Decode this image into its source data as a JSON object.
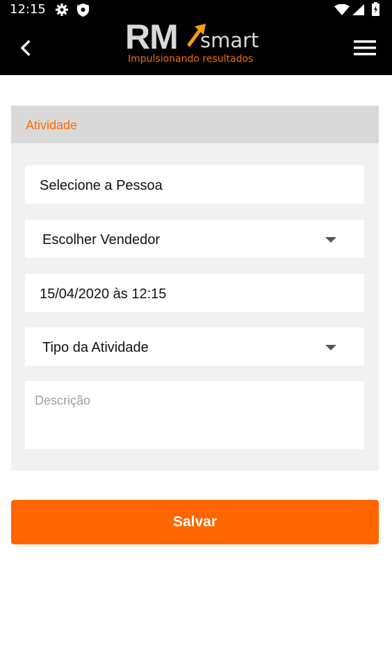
{
  "status_bar": {
    "time": "12:15",
    "icons": [
      "gear-icon",
      "shield-icon",
      "wifi-icon",
      "signal-icon",
      "battery-icon"
    ]
  },
  "app_bar": {
    "back_icon": "chevron-left-icon",
    "menu_icon": "hamburger-menu-icon",
    "logo": {
      "primary": "RM",
      "secondary": "smart",
      "tagline": "Impulsionando resultados"
    }
  },
  "form": {
    "title": "Atividade",
    "person_field": "Selecione a Pessoa",
    "seller_select": "Escolher Vendedor",
    "datetime_field": "15/04/2020 às 12:15",
    "activity_type_select": "Tipo da Atividade",
    "description_placeholder": "Descrição"
  },
  "actions": {
    "save_label": "Salvar"
  },
  "colors": {
    "accent": "#ff6600",
    "header_bg": "#000000",
    "card_bg": "#f1f1f1",
    "card_header_bg": "#d9d9d9"
  }
}
